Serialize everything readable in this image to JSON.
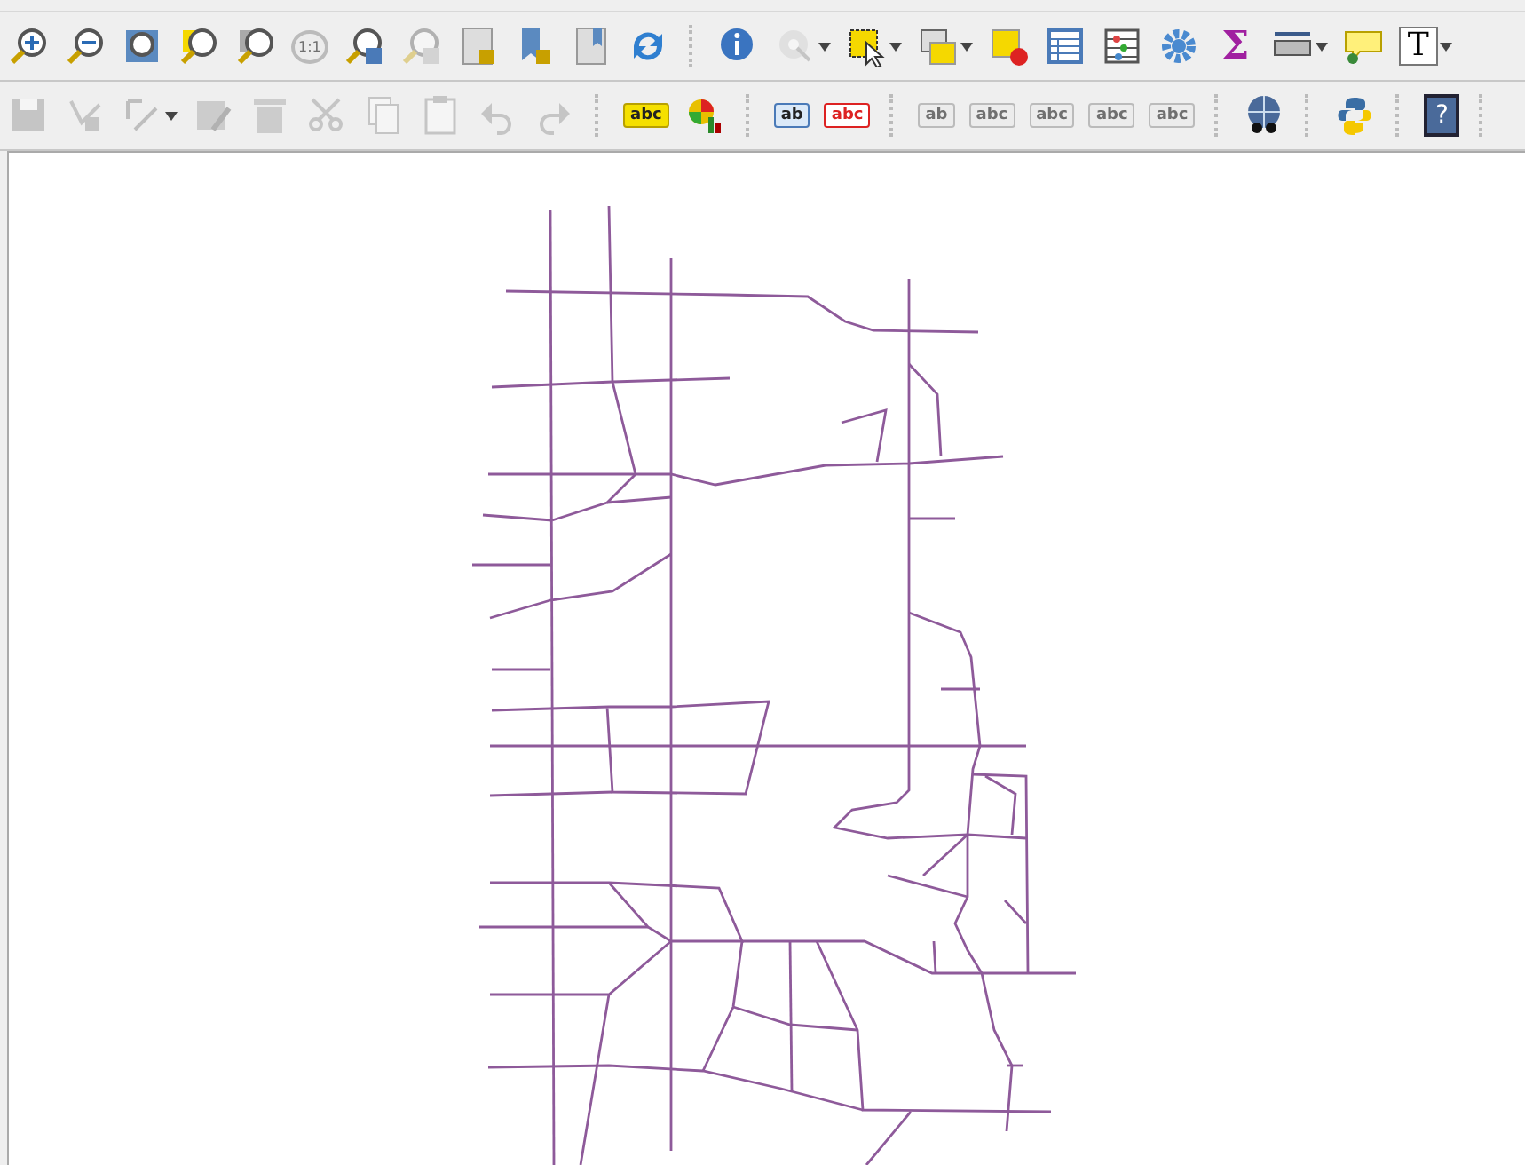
{
  "toolbars": [
    {
      "items": [
        {
          "kind": "button",
          "disabled": false,
          "dropdown": false
        },
        {
          "kind": "button",
          "disabled": false,
          "dropdown": false
        },
        {
          "kind": "button",
          "disabled": false,
          "dropdown": false
        },
        {
          "kind": "button",
          "disabled": false,
          "dropdown": false
        },
        {
          "kind": "button",
          "disabled": false,
          "dropdown": false
        },
        {
          "kind": "button",
          "disabled": true,
          "dropdown": false,
          "glyph": "1:1"
        },
        {
          "kind": "button",
          "disabled": false,
          "dropdown": false
        },
        {
          "kind": "button",
          "disabled": true,
          "dropdown": false
        },
        {
          "kind": "button",
          "disabled": false,
          "dropdown": false
        },
        {
          "kind": "button",
          "disabled": false,
          "dropdown": false
        },
        {
          "kind": "button",
          "disabled": false,
          "dropdown": false
        },
        {
          "kind": "button",
          "disabled": false,
          "dropdown": false
        },
        {
          "kind": "separator"
        },
        {
          "kind": "button",
          "disabled": false,
          "dropdown": false
        },
        {
          "kind": "button",
          "disabled": true,
          "dropdown": true
        },
        {
          "kind": "button",
          "disabled": false,
          "dropdown": true
        },
        {
          "kind": "button",
          "disabled": false,
          "dropdown": true
        },
        {
          "kind": "button",
          "disabled": false,
          "dropdown": false
        },
        {
          "kind": "button",
          "disabled": false,
          "dropdown": false
        },
        {
          "kind": "button",
          "disabled": false,
          "dropdown": false
        },
        {
          "kind": "button",
          "disabled": false,
          "dropdown": false
        },
        {
          "kind": "button",
          "disabled": false,
          "dropdown": false,
          "glyph": "Σ"
        },
        {
          "kind": "button",
          "disabled": false,
          "dropdown": true
        },
        {
          "kind": "button",
          "disabled": false,
          "dropdown": false
        },
        {
          "kind": "button",
          "disabled": false,
          "dropdown": true,
          "glyph": "T"
        }
      ]
    },
    {
      "items": [
        {
          "kind": "button",
          "disabled": true,
          "dropdown": false
        },
        {
          "kind": "button",
          "disabled": true,
          "dropdown": false
        },
        {
          "kind": "button",
          "disabled": true,
          "dropdown": true
        },
        {
          "kind": "button",
          "disabled": true,
          "dropdown": false
        },
        {
          "kind": "button",
          "disabled": true,
          "dropdown": false
        },
        {
          "kind": "button",
          "disabled": true,
          "dropdown": false
        },
        {
          "kind": "button",
          "disabled": true,
          "dropdown": false
        },
        {
          "kind": "button",
          "disabled": true,
          "dropdown": false
        },
        {
          "kind": "button",
          "disabled": true,
          "dropdown": false
        },
        {
          "kind": "button",
          "disabled": true,
          "dropdown": false
        },
        {
          "kind": "separator"
        },
        {
          "kind": "button",
          "disabled": false,
          "dropdown": false,
          "glyph": "abc"
        },
        {
          "kind": "button",
          "disabled": false,
          "dropdown": false
        },
        {
          "kind": "separator"
        },
        {
          "kind": "button",
          "disabled": false,
          "dropdown": false,
          "glyph": "ab"
        },
        {
          "kind": "button",
          "disabled": false,
          "dropdown": false,
          "glyph": "abc"
        },
        {
          "kind": "separator"
        },
        {
          "kind": "button",
          "disabled": true,
          "dropdown": false,
          "glyph": "ab"
        },
        {
          "kind": "button",
          "disabled": true,
          "dropdown": false,
          "glyph": "abc"
        },
        {
          "kind": "button",
          "disabled": true,
          "dropdown": false,
          "glyph": "abc"
        },
        {
          "kind": "button",
          "disabled": true,
          "dropdown": false,
          "glyph": "abc"
        },
        {
          "kind": "button",
          "disabled": true,
          "dropdown": false,
          "glyph": "abc"
        },
        {
          "kind": "separator"
        },
        {
          "kind": "button",
          "disabled": false,
          "dropdown": false
        },
        {
          "kind": "separator"
        },
        {
          "kind": "button",
          "disabled": false,
          "dropdown": false
        },
        {
          "kind": "separator"
        },
        {
          "kind": "button",
          "disabled": false,
          "dropdown": false,
          "glyph": "?"
        },
        {
          "kind": "separator"
        }
      ]
    }
  ]
}
